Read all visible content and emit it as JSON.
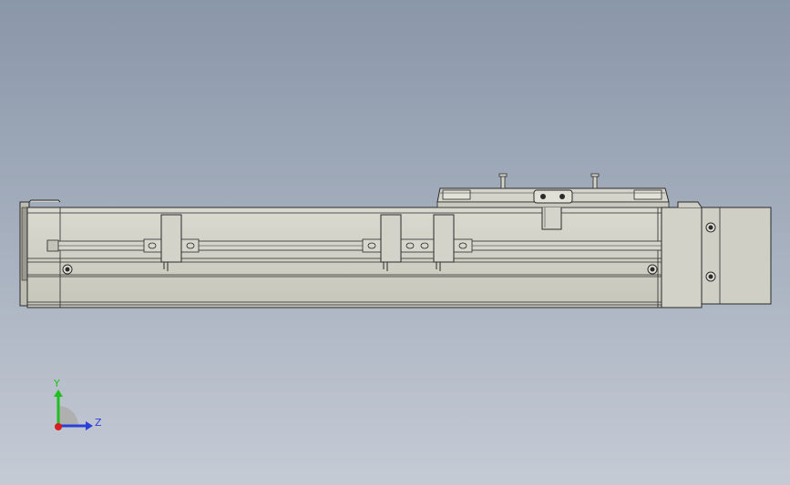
{
  "viewport": {
    "background_top": "#8a97a9",
    "background_bottom": "#c5cbd5"
  },
  "model": {
    "body_color": "#cfcfc4",
    "edge_color": "#2b2b2b"
  },
  "triad": {
    "y_label": "Y",
    "z_label": "Z",
    "y_color": "#1fbf1f",
    "z_color": "#2a3fd8",
    "x_color": "#d81f1f",
    "icons": [
      "y-axis-arrow-icon",
      "z-axis-arrow-icon",
      "x-axis-origin-icon"
    ]
  }
}
